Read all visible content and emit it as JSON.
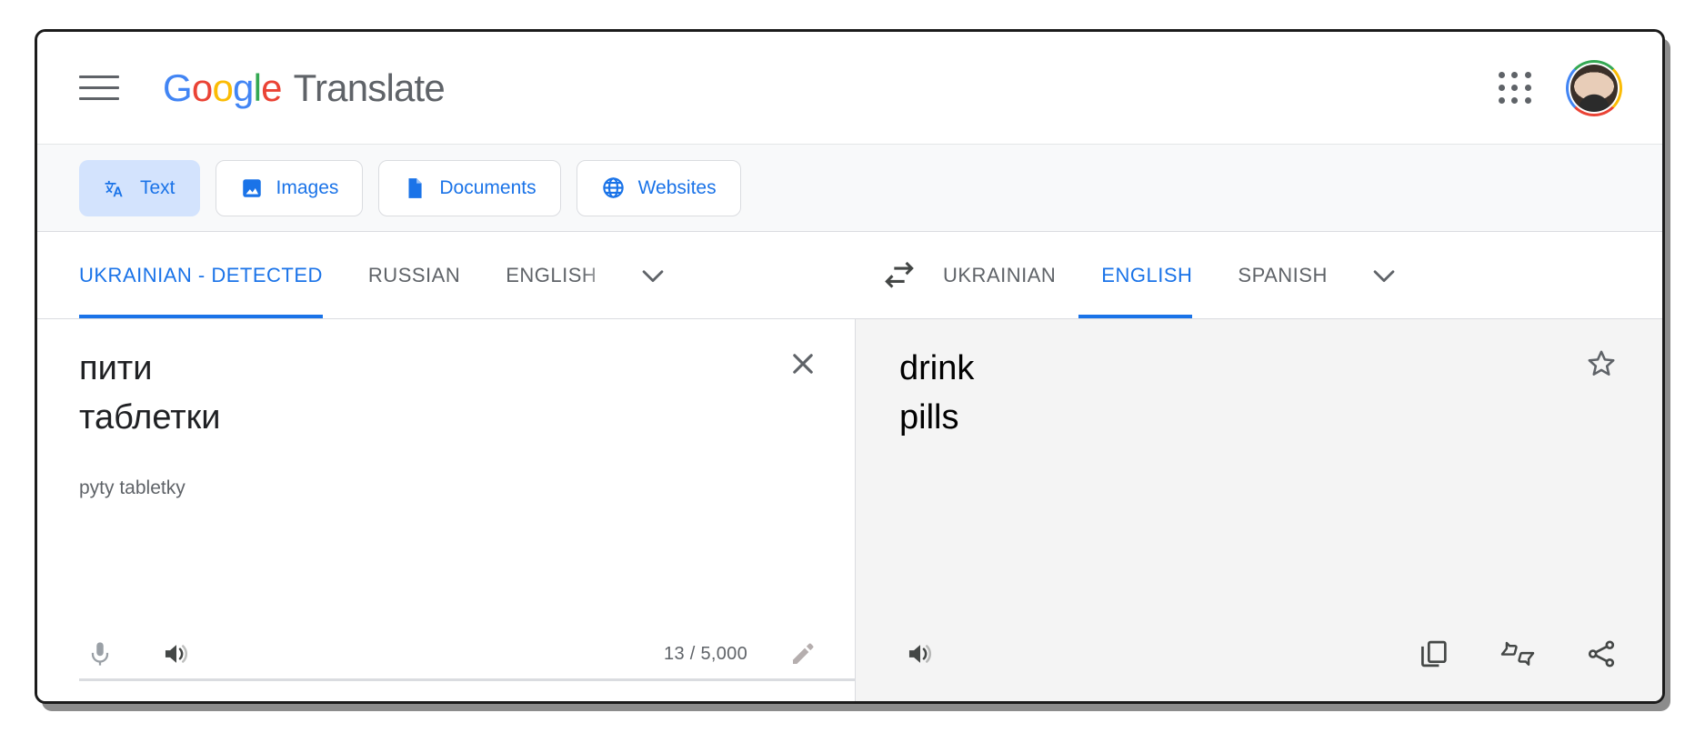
{
  "app": {
    "brand_google": "Google",
    "brand_word": "Translate",
    "menu_icon": "hamburger-menu-icon",
    "apps_icon": "apps-grid-icon",
    "avatar_label": "account-avatar"
  },
  "colors": {
    "blue": "#1a73e8",
    "google_blue": "#4285F4",
    "google_red": "#EA4335",
    "google_yellow": "#FBBC05",
    "google_green": "#34A853",
    "grey_text": "#5f6368",
    "chip_active_bg": "#d3e3fd",
    "target_pane_bg": "#f4f4f4"
  },
  "modes": [
    {
      "label": "Text",
      "icon": "translate-icon",
      "active": true
    },
    {
      "label": "Images",
      "icon": "image-icon",
      "active": false
    },
    {
      "label": "Documents",
      "icon": "document-icon",
      "active": false
    },
    {
      "label": "Websites",
      "icon": "globe-icon",
      "active": false
    }
  ],
  "source_languages": [
    {
      "label": "UKRAINIAN - DETECTED",
      "active": true
    },
    {
      "label": "RUSSIAN",
      "active": false
    },
    {
      "label": "ENGLISH",
      "active": false
    }
  ],
  "target_languages": [
    {
      "label": "UKRAINIAN",
      "active": false
    },
    {
      "label": "ENGLISH",
      "active": true
    },
    {
      "label": "SPANISH",
      "active": false
    }
  ],
  "controls": {
    "source_more": "chevron-down-icon",
    "target_more": "chevron-down-icon",
    "swap": "swap-languages-icon"
  },
  "source": {
    "text": "пити\nтаблетки",
    "transliteration": "pyty tabletky",
    "char_count": "13 / 5,000",
    "clear_icon": "close-icon",
    "mic_icon": "microphone-icon",
    "speaker_icon": "speaker-icon",
    "edit_icon": "pencil-icon"
  },
  "target": {
    "text": "drink\npills",
    "star_icon": "star-outline-icon",
    "speaker_icon": "speaker-icon",
    "copy_icon": "copy-icon",
    "feedback_icon": "thumbs-feedback-icon",
    "share_icon": "share-icon"
  }
}
